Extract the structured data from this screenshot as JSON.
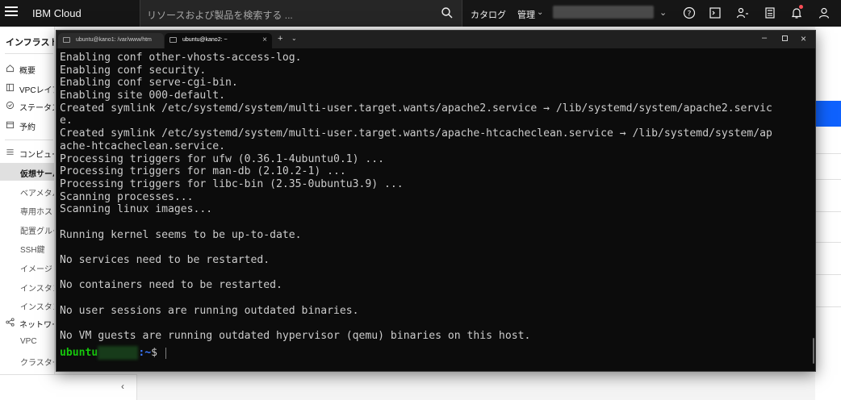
{
  "topbar": {
    "brand": "IBM Cloud",
    "search_placeholder": "リソースおよび製品を検索する ...",
    "catalog": "カタログ",
    "manage": "管理"
  },
  "sidebar": {
    "title": "インフラストラクチャー",
    "items": [
      {
        "label": "概要",
        "icon": "home-icon"
      },
      {
        "label": "VPCレイアウト",
        "icon": "layout-icon"
      },
      {
        "label": "ステータス",
        "icon": "status-icon"
      },
      {
        "label": "予約",
        "icon": "calendar-icon"
      }
    ],
    "compute_label": "コンピュート",
    "compute_items": [
      "仮想サーバー",
      "ベアメタル・サーバー",
      "専用ホスト",
      "配置グループ",
      "SSH鍵",
      "イメージ",
      "インスタンス・グループ",
      "インスタンス・テンプレート"
    ],
    "network_label": "ネットワーク",
    "network_items": [
      "VPC",
      "クラスター・ネットワーク"
    ]
  },
  "terminal": {
    "tabs": [
      {
        "label": "ubuntu@kano1: /var/www/htm"
      },
      {
        "label": "ubuntu@kano2: ~"
      }
    ],
    "lines": [
      "Enabling conf other-vhosts-access-log.",
      "Enabling conf security.",
      "Enabling conf serve-cgi-bin.",
      "Enabling site 000-default.",
      "Created symlink /etc/systemd/system/multi-user.target.wants/apache2.service → /lib/systemd/system/apache2.servic",
      "e.",
      "Created symlink /etc/systemd/system/multi-user.target.wants/apache-htcacheclean.service → /lib/systemd/system/ap",
      "ache-htcacheclean.service.",
      "Processing triggers for ufw (0.36.1-4ubuntu0.1) ...",
      "Processing triggers for man-db (2.10.2-1) ...",
      "Processing triggers for libc-bin (2.35-0ubuntu3.9) ...",
      "Scanning processes...",
      "Scanning linux images...",
      "",
      "Running kernel seems to be up-to-date.",
      "",
      "No services need to be restarted.",
      "",
      "No containers need to be restarted.",
      "",
      "No user sessions are running outdated binaries.",
      "",
      "No VM guests are running outdated hypervisor (qemu) binaries on this host."
    ],
    "prompt_user": "ubuntu",
    "prompt_path": ":~",
    "prompt_sign": "$"
  }
}
